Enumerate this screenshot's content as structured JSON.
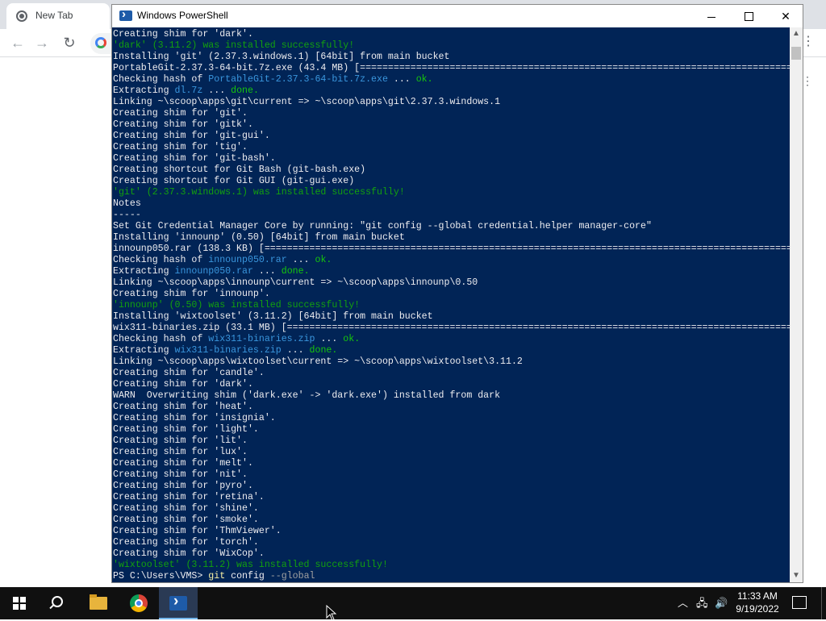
{
  "chrome": {
    "tab_title": "New Tab"
  },
  "powershell": {
    "title": "Windows PowerShell",
    "lines": [
      {
        "t": "Creating shim for 'dark'.",
        "c": ""
      },
      {
        "t": "'dark' (3.11.2) was installed successfully!",
        "c": "c-green"
      },
      {
        "t": "Installing 'git' (2.37.3.windows.1) [64bit] from main bucket",
        "c": ""
      },
      {
        "t": "PortableGit-2.37.3-64-bit.7z.exe (43.4 MB) [================================================================================] 100%",
        "c": ""
      },
      {
        "parts": [
          {
            "t": "Checking hash of ",
            "c": ""
          },
          {
            "t": "PortableGit-2.37.3-64-bit.7z.exe",
            "c": "c-cyan"
          },
          {
            "t": " ... ",
            "c": ""
          },
          {
            "t": "ok.",
            "c": "c-lgreen"
          }
        ]
      },
      {
        "parts": [
          {
            "t": "Extracting ",
            "c": ""
          },
          {
            "t": "dl.7z",
            "c": "c-cyan"
          },
          {
            "t": " ... ",
            "c": ""
          },
          {
            "t": "done.",
            "c": "c-lgreen"
          }
        ]
      },
      {
        "t": "Linking ~\\scoop\\apps\\git\\current => ~\\scoop\\apps\\git\\2.37.3.windows.1",
        "c": ""
      },
      {
        "t": "Creating shim for 'git'.",
        "c": ""
      },
      {
        "t": "Creating shim for 'gitk'.",
        "c": ""
      },
      {
        "t": "Creating shim for 'git-gui'.",
        "c": ""
      },
      {
        "t": "Creating shim for 'tig'.",
        "c": ""
      },
      {
        "t": "Creating shim for 'git-bash'.",
        "c": ""
      },
      {
        "t": "Creating shortcut for Git Bash (git-bash.exe)",
        "c": ""
      },
      {
        "t": "Creating shortcut for Git GUI (git-gui.exe)",
        "c": ""
      },
      {
        "t": "'git' (2.37.3.windows.1) was installed successfully!",
        "c": "c-green"
      },
      {
        "t": "Notes",
        "c": ""
      },
      {
        "t": "-----",
        "c": ""
      },
      {
        "t": "Set Git Credential Manager Core by running: \"git config --global credential.helper manager-core\"",
        "c": ""
      },
      {
        "t": "Installing 'innounp' (0.50) [64bit] from main bucket",
        "c": ""
      },
      {
        "t": "innounp050.rar (138.3 KB) [=================================================================================================] 100%",
        "c": ""
      },
      {
        "parts": [
          {
            "t": "Checking hash of ",
            "c": ""
          },
          {
            "t": "innounp050.rar",
            "c": "c-cyan"
          },
          {
            "t": " ... ",
            "c": ""
          },
          {
            "t": "ok.",
            "c": "c-lgreen"
          }
        ]
      },
      {
        "parts": [
          {
            "t": "Extracting ",
            "c": ""
          },
          {
            "t": "innounp050.rar",
            "c": "c-cyan"
          },
          {
            "t": " ... ",
            "c": ""
          },
          {
            "t": "done.",
            "c": "c-lgreen"
          }
        ]
      },
      {
        "t": "Linking ~\\scoop\\apps\\innounp\\current => ~\\scoop\\apps\\innounp\\0.50",
        "c": ""
      },
      {
        "t": "Creating shim for 'innounp'.",
        "c": ""
      },
      {
        "t": "'innounp' (0.50) was installed successfully!",
        "c": "c-green"
      },
      {
        "t": "Installing 'wixtoolset' (3.11.2) [64bit] from main bucket",
        "c": ""
      },
      {
        "t": "wix311-binaries.zip (33.1 MB) [============================================================================================] 100%",
        "c": ""
      },
      {
        "parts": [
          {
            "t": "Checking hash of ",
            "c": ""
          },
          {
            "t": "wix311-binaries.zip",
            "c": "c-cyan"
          },
          {
            "t": " ... ",
            "c": ""
          },
          {
            "t": "ok.",
            "c": "c-lgreen"
          }
        ]
      },
      {
        "parts": [
          {
            "t": "Extracting ",
            "c": ""
          },
          {
            "t": "wix311-binaries.zip",
            "c": "c-cyan"
          },
          {
            "t": " ... ",
            "c": ""
          },
          {
            "t": "done.",
            "c": "c-lgreen"
          }
        ]
      },
      {
        "t": "Linking ~\\scoop\\apps\\wixtoolset\\current => ~\\scoop\\apps\\wixtoolset\\3.11.2",
        "c": ""
      },
      {
        "t": "Creating shim for 'candle'.",
        "c": ""
      },
      {
        "t": "Creating shim for 'dark'.",
        "c": ""
      },
      {
        "t": "WARN  Overwriting shim ('dark.exe' -> 'dark.exe') installed from dark",
        "c": ""
      },
      {
        "t": "Creating shim for 'heat'.",
        "c": ""
      },
      {
        "t": "Creating shim for 'insignia'.",
        "c": ""
      },
      {
        "t": "Creating shim for 'light'.",
        "c": ""
      },
      {
        "t": "Creating shim for 'lit'.",
        "c": ""
      },
      {
        "t": "Creating shim for 'lux'.",
        "c": ""
      },
      {
        "t": "Creating shim for 'melt'.",
        "c": ""
      },
      {
        "t": "Creating shim for 'nit'.",
        "c": ""
      },
      {
        "t": "Creating shim for 'pyro'.",
        "c": ""
      },
      {
        "t": "Creating shim for 'retina'.",
        "c": ""
      },
      {
        "t": "Creating shim for 'shine'.",
        "c": ""
      },
      {
        "t": "Creating shim for 'smoke'.",
        "c": ""
      },
      {
        "t": "Creating shim for 'ThmViewer'.",
        "c": ""
      },
      {
        "t": "Creating shim for 'torch'.",
        "c": ""
      },
      {
        "t": "Creating shim for 'WixCop'.",
        "c": ""
      },
      {
        "t": "'wixtoolset' (3.11.2) was installed successfully!",
        "c": "c-green"
      }
    ],
    "prompt": "PS C:\\Users\\VMS> ",
    "command": "git",
    "command_args": " config ",
    "command_flag": "--global"
  },
  "taskbar": {
    "time": "11:33 AM",
    "date": "9/19/2022"
  },
  "icons": {
    "start": "windows-start-icon",
    "search": "search-icon",
    "explorer": "file-explorer-icon",
    "chrome": "chrome-icon",
    "powershell": "powershell-icon"
  },
  "colors": {
    "console_bg": "#012456",
    "success_green": "#13a10e",
    "path_cyan": "#3a96dd",
    "ok_green": "#16c60c",
    "command_yellow": "#f9f1a5"
  }
}
